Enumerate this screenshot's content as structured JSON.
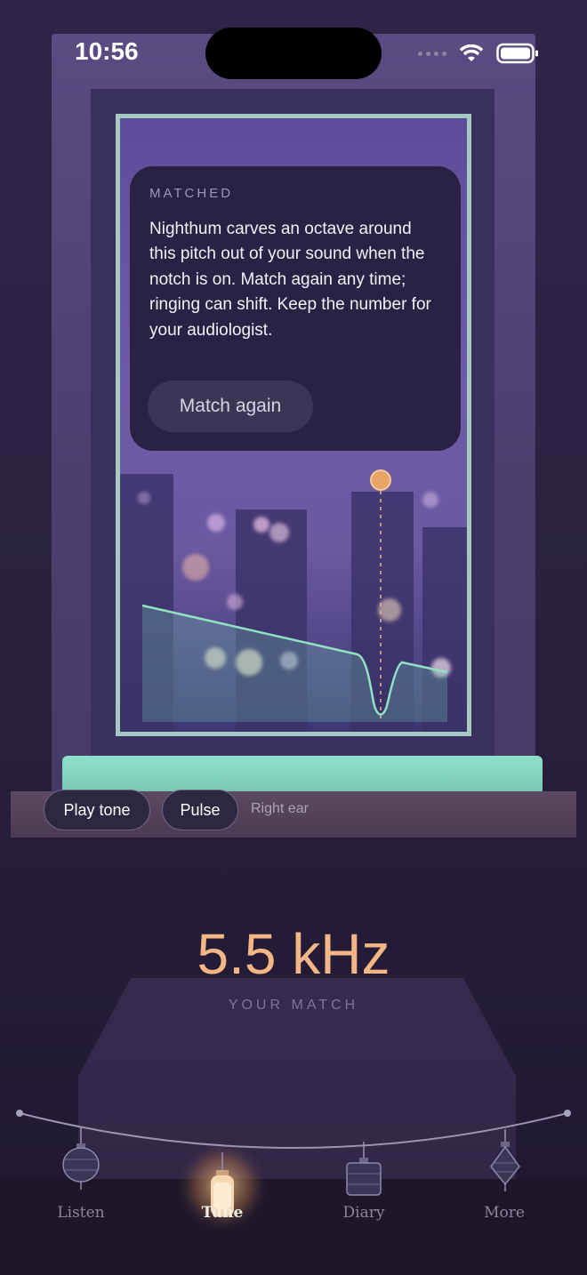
{
  "status_bar": {
    "time": "10:56",
    "icons": [
      "cellular-icon",
      "wifi-icon",
      "battery-icon"
    ]
  },
  "card": {
    "eyebrow": "MATCHED",
    "body": "Nighthum carves an octave around this pitch out of your sound when the notch is on. Match again any time; ringing can shift. Keep the number for your audiologist.",
    "button_label": "Match again"
  },
  "controls": {
    "play_tone_label": "Play tone",
    "pulse_label": "Pulse",
    "ear_label": "Right ear"
  },
  "match": {
    "frequency": "5.5 kHz",
    "label": "YOUR MATCH"
  },
  "tabs": [
    {
      "label": "Listen",
      "icon": "lantern-round-icon",
      "active": false
    },
    {
      "label": "Tune",
      "icon": "lantern-lit-icon",
      "active": true
    },
    {
      "label": "Diary",
      "icon": "lantern-square-icon",
      "active": false
    },
    {
      "label": "More",
      "icon": "lantern-diamond-icon",
      "active": false
    }
  ],
  "colors": {
    "accent": "#f4b684",
    "curve": "#8fe2c4",
    "card_bg": "#2a2244",
    "sill": "#8ee0c8"
  }
}
